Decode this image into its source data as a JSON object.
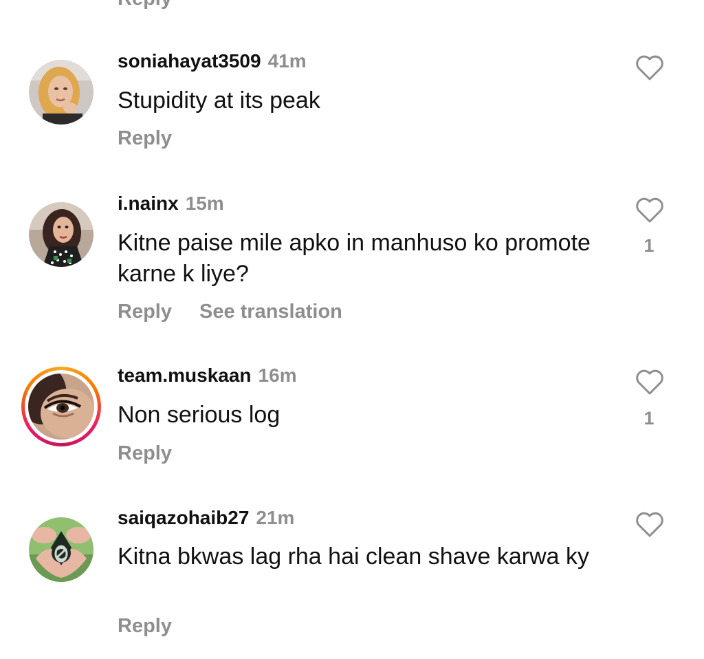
{
  "top": {
    "reply_label": "Reply"
  },
  "comments": [
    {
      "username": "soniahayat3509",
      "time": "41m",
      "text": "Stupidity at its peak",
      "actions": [
        "Reply"
      ],
      "likes": "",
      "avatar_icon": "avatar-soniahayat3509"
    },
    {
      "username": "i.nainx",
      "time": "15m",
      "text": "Kitne paise mile apko in manhuso ko promote karne k liye?",
      "actions": [
        "Reply",
        "See translation"
      ],
      "likes": "1",
      "avatar_icon": "avatar-i-nainx"
    },
    {
      "username": "team.muskaan",
      "time": "16m",
      "text": "Non serious log",
      "actions": [
        "Reply"
      ],
      "likes": "1",
      "avatar_icon": "avatar-team-muskaan-with-story-ring"
    },
    {
      "username": "saiqazohaib27",
      "time": "21m",
      "text": "Kitna bkwas lag rha hai clean shave karwa ky",
      "actions": [
        "Reply"
      ],
      "likes": "",
      "avatar_icon": "avatar-saiqazohaib27"
    }
  ],
  "colors": {
    "text": "#111111",
    "secondary": "#8e8e8e",
    "background": "#ffffff",
    "story_ring_start": "#f9a825",
    "story_ring_end": "#e91e63"
  }
}
